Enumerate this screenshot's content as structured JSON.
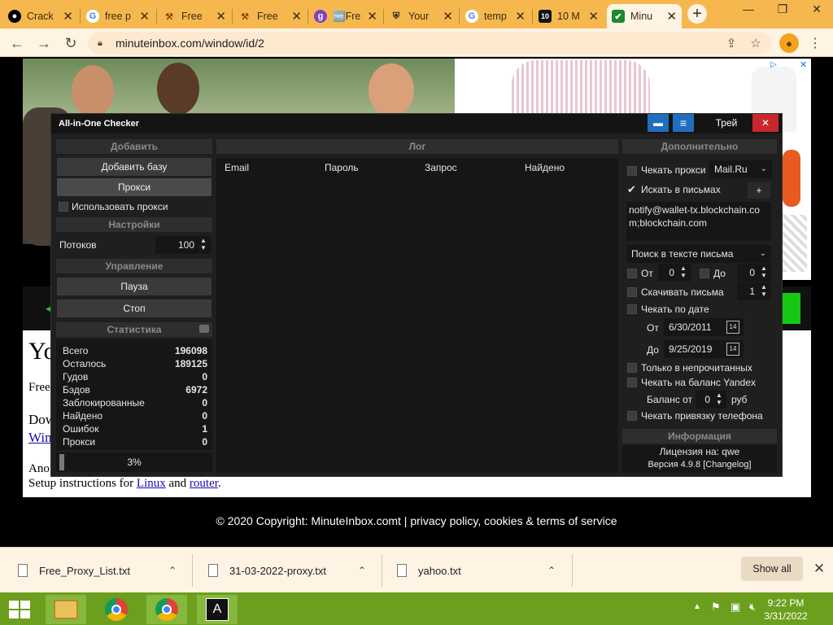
{
  "browser": {
    "tabs": [
      {
        "title": "Crack",
        "icon": "github-icon"
      },
      {
        "title": "free p",
        "icon": "google-icon"
      },
      {
        "title": "Free",
        "icon": "proxy-icon"
      },
      {
        "title": "Free",
        "icon": "proxy-icon"
      },
      {
        "title": "🆓Fre",
        "icon": "g-letter-icon"
      },
      {
        "title": "Your",
        "icon": "shield-icon"
      },
      {
        "title": "temp",
        "icon": "google-icon"
      },
      {
        "title": "10 M",
        "icon": "ten-icon"
      },
      {
        "title": "Minu",
        "icon": "minuteinbox-icon"
      }
    ],
    "new_tab": "+",
    "url": "minuteinbox.com/window/id/2",
    "window_controls": [
      "—",
      "❐",
      "✕"
    ]
  },
  "page": {
    "heading": "Yo",
    "lines": [
      "Free",
      "Dow",
      "Win",
      "Ano"
    ],
    "setup": {
      "prefix": "Setup instructions for ",
      "link1": "Linux",
      "middle": " and ",
      "link2": "router",
      "suffix": "."
    },
    "footer": "© 2020 Copyright: MinuteInbox.comt | privacy policy, cookies & terms of service"
  },
  "checker": {
    "title": "All-in-One Checker",
    "title_buttons": {
      "tray": "Трей",
      "close": "✕"
    },
    "add": {
      "section": "Добавить",
      "add_db": "Добавить базу",
      "proxy": "Прокси",
      "use_proxy": "Использовать прокси"
    },
    "settings": {
      "section": "Настройки",
      "threads_label": "Потоков",
      "threads_value": "100"
    },
    "control": {
      "section": "Управление",
      "pause": "Пауза",
      "stop": "Стоп"
    },
    "stats": {
      "section": "Статистика",
      "rows": [
        {
          "label": "Всего",
          "value": "196098"
        },
        {
          "label": "Осталось",
          "value": "189125"
        },
        {
          "label": "Гудов",
          "value": "0"
        },
        {
          "label": "Бэдов",
          "value": "6972"
        },
        {
          "label": "Заблокированные",
          "value": "0"
        },
        {
          "label": "Найдено",
          "value": "0"
        },
        {
          "label": "Ошибок",
          "value": "1"
        },
        {
          "label": "Прокси",
          "value": "0"
        }
      ],
      "progress_text": "3%",
      "progress": 0.03
    },
    "log": {
      "section": "Лог",
      "columns": [
        "Email",
        "Пароль",
        "Запрос",
        "Найдено"
      ]
    },
    "extra": {
      "section": "Дополнительно",
      "check_proxy": "Чекать прокси",
      "proxy_target": "Mail.Ru",
      "search_letters": "Искать в письмах",
      "search_letters_checked": true,
      "plus": "+",
      "query": "notify@wallet-tx.blockchain.com;blockchain.com",
      "search_mode": "Поиск в тексте письма",
      "from_label": "От",
      "from_value": "0",
      "to_label": "До",
      "to_value": "0",
      "download_letters": "Скачивать письма",
      "download_value": "1",
      "check_by_date": "Чекать по дате",
      "date_from_label": "От",
      "date_from": "6/30/2011",
      "date_to_label": "До",
      "date_to": "9/25/2019",
      "unread_only": "Только в непрочитанных",
      "check_yandex_balance": "Чекать на баланс Yandex",
      "balance_from_label": "Баланс от",
      "balance_from_value": "0",
      "balance_currency": "руб",
      "check_phone_binding": "Чекать привязку телефона"
    },
    "info": {
      "section": "Информация",
      "license": "Лицензия на: qwe",
      "version": "Версия 4.9.8 [Changelog]"
    }
  },
  "downloads": {
    "items": [
      "Free_Proxy_List.txt",
      "31-03-2022-proxy.txt",
      "yahoo.txt"
    ],
    "show_all": "Show all",
    "close": "✕"
  },
  "taskbar": {
    "time": "9:22 PM",
    "date": "3/31/2022",
    "active_app_letter": "A"
  }
}
